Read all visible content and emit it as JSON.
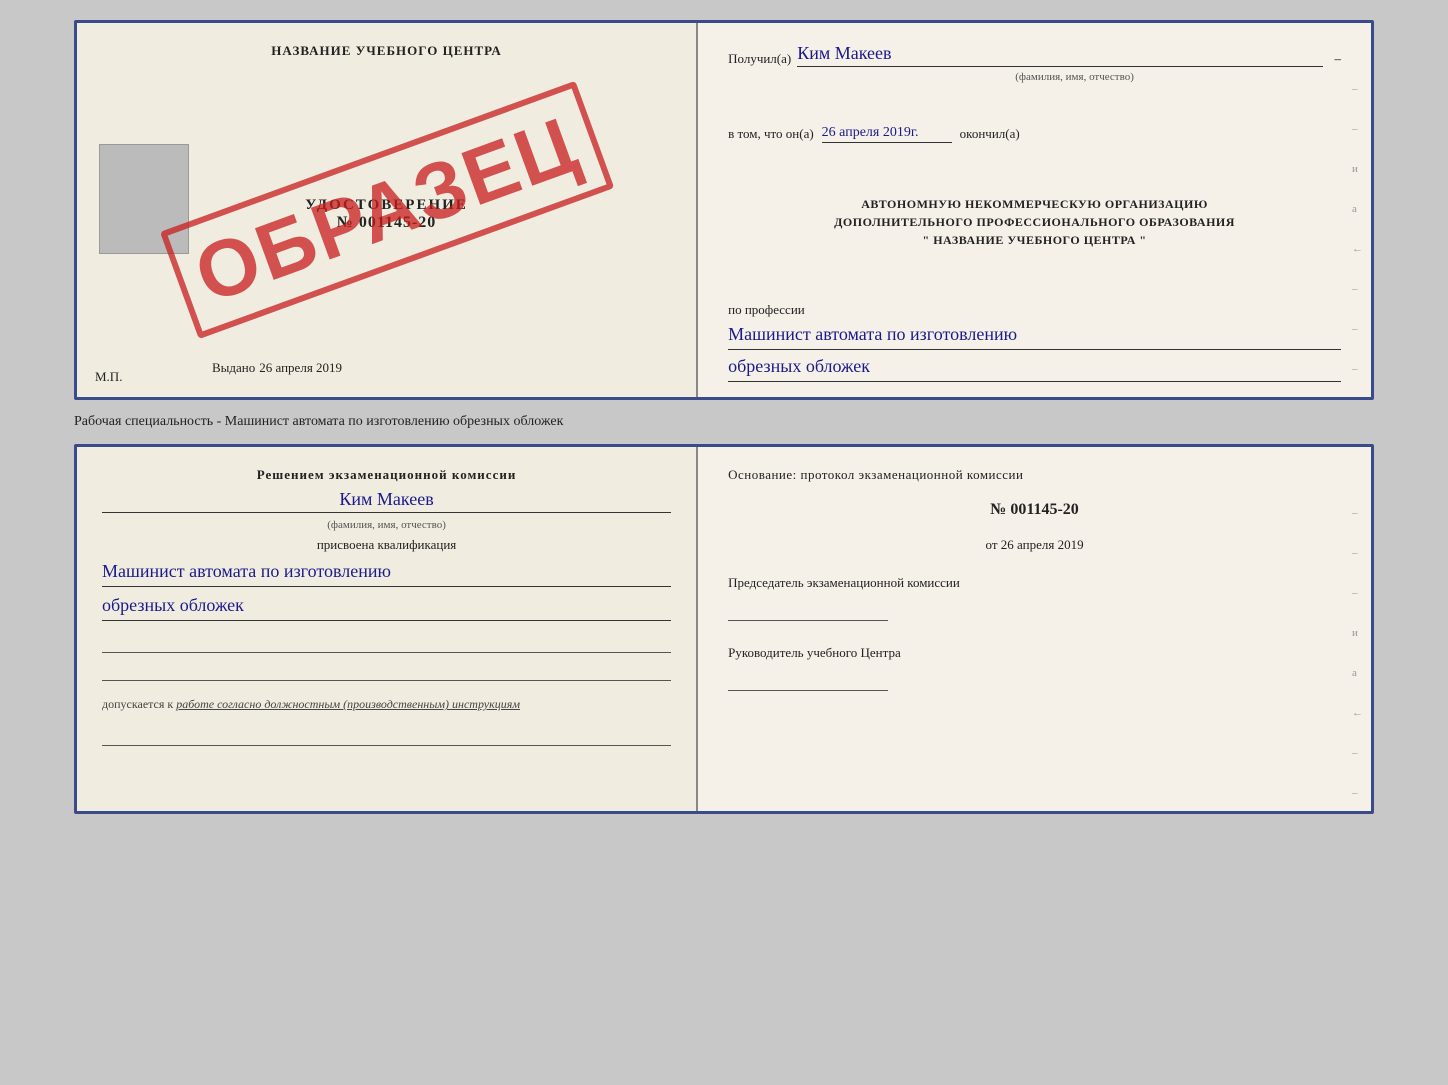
{
  "top_cert": {
    "left": {
      "school_name": "НАЗВАНИЕ УЧЕБНОГО ЦЕНТРА",
      "doc_label": "УДОСТОВЕРЕНИЕ",
      "doc_number": "№ 001145-20",
      "issued_prefix": "Выдано",
      "issued_date": "26 апреля 2019",
      "mp_label": "М.П.",
      "watermark": "ОБРАЗЕЦ"
    },
    "right": {
      "recipient_label": "Получил(а)",
      "recipient_name": "Ким Макеев",
      "fio_hint": "(фамилия, имя, отчество)",
      "date_label": "в том, что он(а)",
      "date_value": "26 апреля 2019г.",
      "completed_label": "окончил(а)",
      "org_line1": "АВТОНОМНУЮ НЕКОММЕРЧЕСКУЮ ОРГАНИЗАЦИЮ",
      "org_line2": "ДОПОЛНИТЕЛЬНОГО ПРОФЕССИОНАЛЬНОГО ОБРАЗОВАНИЯ",
      "org_line3": "\"    НАЗВАНИЕ УЧЕБНОГО ЦЕНТРА    \"",
      "profession_label": "по профессии",
      "profession_value1": "Машинист автомата по изготовлению",
      "profession_value2": "обрезных обложек"
    }
  },
  "middle_text": "Рабочая специальность - Машинист автомата по изготовлению обрезных обложек",
  "bottom_cert": {
    "left": {
      "decision_label": "Решением экзаменационной комиссии",
      "person_name": "Ким Макеев",
      "fio_hint": "(фамилия, имя, отчество)",
      "qualification_label": "присвоена квалификация",
      "qualification_line1": "Машинист автомата по изготовлению",
      "qualification_line2": "обрезных обложек",
      "admitted_text": "допускается к",
      "admitted_italic": "работе согласно должностным (производственным) инструкциям"
    },
    "right": {
      "osnование_label": "Основание: протокол экзаменационной комиссии",
      "protocol_number": "№ 001145-20",
      "protocol_date_prefix": "от",
      "protocol_date": "26 апреля 2019",
      "chairman_label": "Председатель экзаменационной комиссии",
      "center_leader_label": "Руководитель учебного Центра"
    }
  }
}
